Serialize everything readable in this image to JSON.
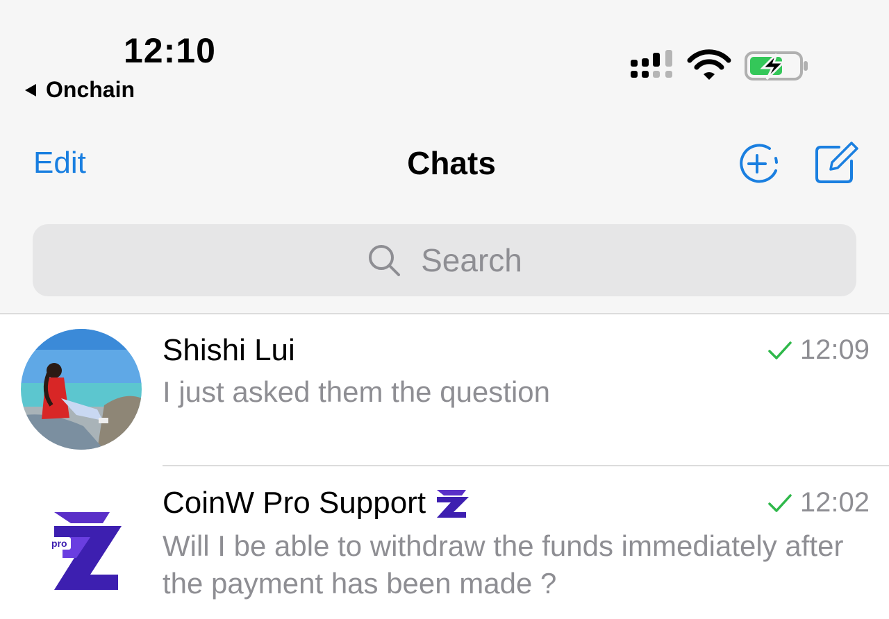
{
  "status_bar": {
    "time": "12:10",
    "back_label": "Onchain",
    "battery_color": "#34c759"
  },
  "nav": {
    "edit_label": "Edit",
    "title": "Chats",
    "accent_color": "#1a7fe0"
  },
  "search": {
    "placeholder": "Search"
  },
  "chats": [
    {
      "name": "Shishi Lui",
      "time": "12:09",
      "message": "I just asked them the question",
      "read_status": "sent-check"
    },
    {
      "name": "CoinW Pro Support",
      "time": "12:02",
      "message": "Will I be able to withdraw the funds immediately after the payment has been made ?",
      "read_status": "sent-check",
      "avatar_label": "pro"
    }
  ]
}
